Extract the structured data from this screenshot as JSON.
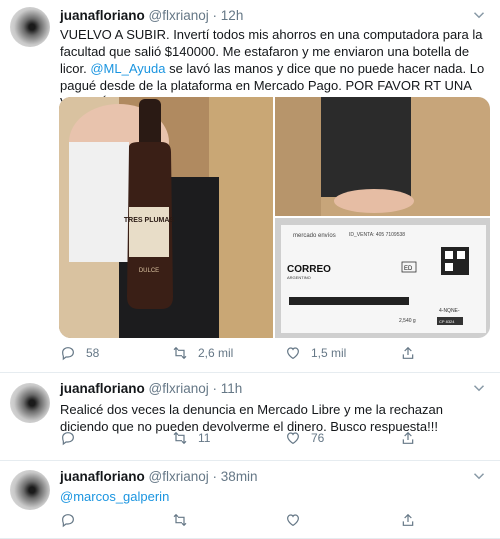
{
  "tweets": [
    {
      "display_name": "juanafloriano",
      "handle": "@flxrianoj",
      "time": "12h",
      "text_before": "VUELVO A SUBIR. Invertí todos mis ahorros en una computadora para la facultad que salió $140000. Me estafaron y me enviaron una botella de licor. ",
      "mention": "@ML_Ayuda",
      "text_after": " se lavó las manos y dice que no puede hacer nada. Lo pagué desde de la plataforma en Mercado Pago. POR FAVOR RT UNA VEZ MÁS",
      "media": {
        "bottle_label": "TRES PLUMAS",
        "bottle_sublabel": "DULCE",
        "package_brand": "mercado envíos",
        "tracking": "ID_VENTA: 405 7109538",
        "carrier": "CORREO",
        "carrier_sub": "ARGENTINO",
        "box_code": "ED",
        "weight": "2,540 g",
        "route": "4-NQNE-",
        "zone_code": "CP 8324"
      },
      "replies": "58",
      "retweets": "2,6 mil",
      "likes": "1,5 mil"
    },
    {
      "display_name": "juanafloriano",
      "handle": "@flxrianoj",
      "time": "11h",
      "text": "Realicé dos veces la denuncia en Mercado Libre y me la rechazan diciendo que no pueden devolverme el dinero. Busco respuesta!!!",
      "replies": "",
      "retweets": "11",
      "likes": "76"
    },
    {
      "display_name": "juanafloriano",
      "handle": "@flxrianoj",
      "time": "38min",
      "mention": "@marcos_galperin",
      "replies": "",
      "retweets": "",
      "likes": ""
    }
  ],
  "colors": {
    "accent": "#1b95e0",
    "muted": "#657786",
    "text": "#14171a",
    "border": "#e6ecf0"
  },
  "icons": [
    "chevron-down-icon",
    "reply-icon",
    "retweet-icon",
    "like-icon",
    "share-icon"
  ]
}
